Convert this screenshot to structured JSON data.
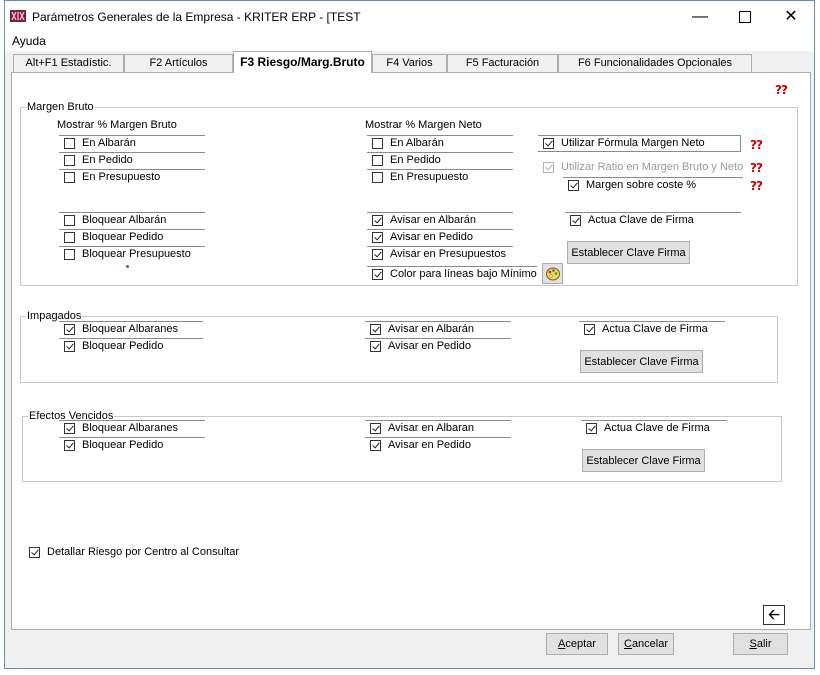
{
  "window": {
    "title": "Parámetros Generales de la Empresa - KRITER ERP - [TEST"
  },
  "menu": {
    "ayuda": "Ayuda"
  },
  "tabs": [
    {
      "label": "Alt+F1 Estadístic."
    },
    {
      "label": "F2 Artículos"
    },
    {
      "label": "F3 Riesgo/Marg.Bruto",
      "active": true
    },
    {
      "label": "F4 Varios"
    },
    {
      "label": "F5 Facturación"
    },
    {
      "label": "F6 Funcionalidades Opcionales"
    }
  ],
  "margen_bruto": {
    "title": "Margen Bruto",
    "mostrar_bruto_title": "Mostrar % Margen Bruto",
    "mostrar_bruto": [
      {
        "label": "En Albarán",
        "checked": false
      },
      {
        "label": "En Pedido",
        "checked": false
      },
      {
        "label": "En Presupuesto",
        "checked": false
      }
    ],
    "bloquear": [
      {
        "label": "Bloquear Albarán",
        "checked": false
      },
      {
        "label": "Bloquear Pedido",
        "checked": false
      },
      {
        "label": "Bloquear Presupuesto",
        "checked": false
      }
    ],
    "mostrar_neto_title": "Mostrar % Margen Neto",
    "mostrar_neto": [
      {
        "label": "En Albarán",
        "checked": false
      },
      {
        "label": "En Pedido",
        "checked": false
      },
      {
        "label": "En Presupuesto",
        "checked": false
      }
    ],
    "avisar": [
      {
        "label": "Avisar en Albarán",
        "checked": true
      },
      {
        "label": "Avisar en Pedido",
        "checked": true
      },
      {
        "label": "Avisar en Presupuestos",
        "checked": true
      }
    ],
    "color_lineas": {
      "label": "Color para líneas bajo Mínimo",
      "checked": true
    },
    "utilizar_formula": {
      "label": "Utilizar Fórmula Margen Neto",
      "checked": true
    },
    "utilizar_ratio": {
      "label": "Utilizar Ratio en Margen Bruto y Neto",
      "checked": true,
      "disabled": true
    },
    "margen_coste": {
      "label": "Margen sobre coste %",
      "checked": true
    },
    "actua_clave": {
      "label": "Actua Clave de Firma",
      "checked": true
    },
    "establecer_clave": "Establecer Clave Firma"
  },
  "impagados": {
    "title": "Impagados",
    "bloquear": [
      {
        "label": "Bloquear Albaranes",
        "checked": true
      },
      {
        "label": "Bloquear Pedido",
        "checked": true
      }
    ],
    "avisar": [
      {
        "label": "Avisar en Albarán",
        "checked": true
      },
      {
        "label": "Avisar en Pedido",
        "checked": true
      }
    ],
    "actua_clave": {
      "label": "Actua Clave de Firma",
      "checked": true
    },
    "establecer_clave": "Establecer Clave Firma"
  },
  "efectos_vencidos": {
    "title": "Efectos Vencidos",
    "bloquear": [
      {
        "label": "Bloquear Albaranes",
        "checked": true
      },
      {
        "label": "Bloquear Pedido",
        "checked": true
      }
    ],
    "avisar": [
      {
        "label": "Avisar en Albaran",
        "checked": true
      },
      {
        "label": "Avisar en Pedido",
        "checked": true
      }
    ],
    "actua_clave": {
      "label": "Actua Clave de Firma",
      "checked": true
    },
    "establecer_clave": "Establecer Clave Firma"
  },
  "detallar_riesgo": {
    "label": "Detallar Riesgo por Centro al Consultar",
    "checked": true
  },
  "footer": {
    "aceptar_first": "A",
    "aceptar_rest": "ceptar",
    "cancelar_first": "C",
    "cancelar_rest": "ancelar",
    "salir_first": "S",
    "salir_rest": "alir"
  },
  "colors": {
    "help_icon": "#cc0000",
    "window_border": "#6b8fb3",
    "link_dot": "#2a6ebb"
  }
}
